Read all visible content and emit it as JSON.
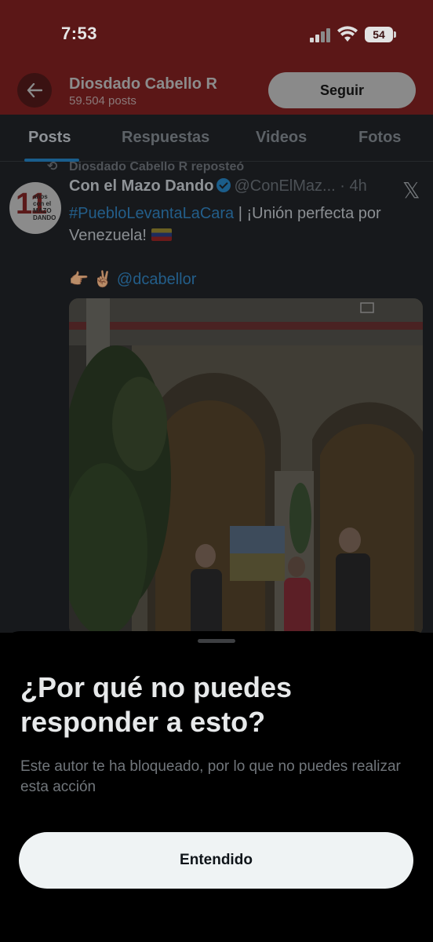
{
  "status_bar": {
    "time": "7:53",
    "battery": "54"
  },
  "header": {
    "profile_name": "Diosdado Cabello R",
    "posts_count": "59.504 posts",
    "follow_label": "Seguir"
  },
  "tabs": [
    {
      "label": "Posts",
      "active": true
    },
    {
      "label": "Respuestas",
      "active": false
    },
    {
      "label": "Videos",
      "active": false
    },
    {
      "label": "Fotos",
      "active": false
    }
  ],
  "post": {
    "repost_line": "Diosdado Cabello R reposteó",
    "avatar_big": "11",
    "avatar_small": "años con el MAZO DANDO",
    "author": "Con el Mazo Dando",
    "handle_time": "@ConElMaz... · 4h",
    "hashtag": "#PuebloLevantaLaCara",
    "text_rest": " | ¡Unión perfecta por Venezuela! ",
    "emoji_line": "👉🏽 ✌🏽 ",
    "mention": "@dcabellor"
  },
  "sheet": {
    "title": "¿Por qué no puedes responder a esto?",
    "body": "Este autor te ha bloqueado, por lo que no puedes realizar esta acción",
    "button_label": "Entendido"
  },
  "colors": {
    "header_red": "#5b1717",
    "accent_blue": "#1d9bf0",
    "sheet_bg": "#000000",
    "button_bg": "#eff3f4"
  }
}
